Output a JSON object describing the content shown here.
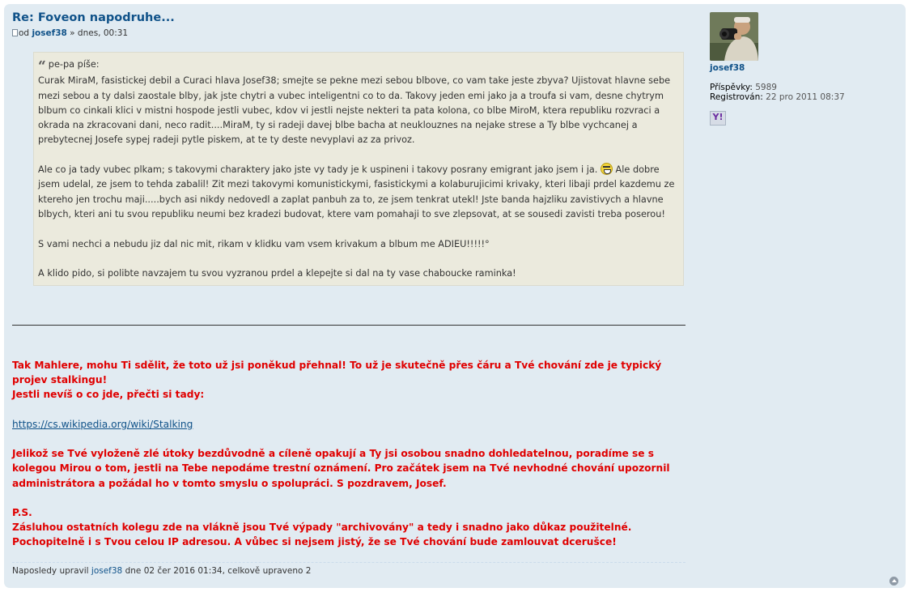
{
  "post": {
    "title": "Re: Foveon napodruhe...",
    "author_prefix": "od",
    "author": "josef38",
    "author_suffix": " » dnes, 00:31"
  },
  "quote": {
    "cite": "pe-pa píše:",
    "p1": "Curak MiraM, fasistickej debil a Curaci hlava Josef38; smejte se pekne mezi sebou blbove, co vam take jeste zbyva? Ujistovat hlavne sebe mezi sebou a ty dalsi zaostale blby, jak jste chytri a vubec inteligentni co to da. Takovy jeden emi jako ja a troufa si vam, desne chytrym blbum co cinkali klici v mistni hospode jestli vubec, kdov vi jestli nejste nekteri ta pata kolona, co blbe MiroM, ktera republiku rozvraci a okrada na zkracovani dani, neco radit....MiraM, ty si radeji davej blbe bacha at neuklouznes na nejake strese a Ty blbe vychcanej a prebytecnej Josefe sypej radeji pytle piskem, at te ty deste nevyplavi az za privoz.",
    "p2a": "Ale co ja tady vubec plkam; s takovymi charaktery jako jste vy tady je k uspineni i takovy posrany emigrant jako jsem i ja. ",
    "p2b": " Ale dobre jsem udelal, ze jsem to tehda zabalil! Zit mezi takovymi komunistickymi, fasistickymi a kolaburujicimi krivaky, kteri libaji prdel kazdemu ze ktereho jen trochu maji.....bych asi nikdy nedovedl a zaplat panbuh za to, ze jsem tenkrat utekl! Jste banda hajzliku zavistivych a hlavne blbych, kteri ani tu svou republiku neumi bez kradezi budovat, ktere vam pomahaji to sve zlepsovat, at se sousedi zavisti treba poserou!",
    "p3": "S vami nechci a nebudu jiz dal nic mit, rikam v klidku vam vsem krivakum a blbum me ADIEU!!!!!°",
    "p4": "A klido pido, si polibte navzajem tu svou vyzranou prdel a klepejte si dal na ty vase chaboucke raminka!"
  },
  "reply": {
    "l1": "Tak Mahlere, mohu Ti sdělit, že toto už jsi poněkud přehnal! To už je skutečně přes čáru a Tvé chování zde je typický projev stalkingu!",
    "l2": "Jestli nevíš o co jde, přečti si tady:",
    "link": "https://cs.wikipedia.org/wiki/Stalking",
    "l3": "Jelikož se Tvé vyloženě zlé útoky bezdůvodně a cíleně opakují a Ty jsi osobou snadno dohledatelnou, poradíme se s kolegou Mirou o tom, jestli na Tebe nepodáme trestní oznámení. Pro začátek jsem na Tvé nevhodné chování upozornil administrátora a požádal ho v tomto smyslu o spolupráci. S pozdravem, Josef.",
    "ps": "P.S.",
    "l4": "Zásluhou ostatních kolegu zde na vlákně jsou Tvé výpady \"archivovány\" a tedy i snadno jako důkaz použitelné. Pochopitelně i s Tvou celou IP adresou. A vůbec si nejsem jistý, že se Tvé chování bude zamlouvat dcerušce!"
  },
  "notice": {
    "prefix": "Naposledy upravil ",
    "user": "josef38",
    "suffix": " dne 02 čer 2016 01:34, celkově upraveno 2"
  },
  "profile": {
    "name": "josef38",
    "posts_label": "Příspěvky:",
    "posts_value": "5989",
    "registered_label": "Registrován:",
    "registered_value": "22 pro 2011 08:37",
    "yahoo_label": "Y!"
  },
  "colors": {
    "panel": "#e1ebf2",
    "link": "#105289",
    "reply_text": "#e00000",
    "quote_bg": "#ebeadd"
  },
  "icons": {
    "post": "post-icon",
    "smiley": "smiley-icon",
    "contact": "yahoo-icon",
    "top": "back-to-top-icon"
  }
}
